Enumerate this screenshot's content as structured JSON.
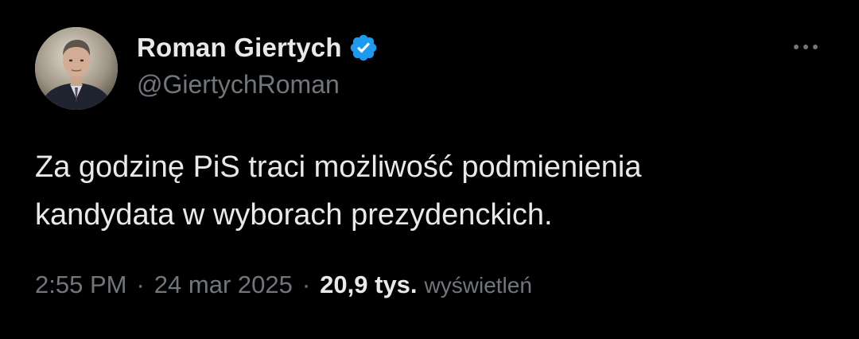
{
  "author": {
    "display_name": "Roman Giertych",
    "handle": "@GiertychRoman",
    "verified": true,
    "avatar_icon": "profile-photo"
  },
  "menu": {
    "icon": "more-horizontal-icon"
  },
  "tweet": {
    "text": "Za godzinę PiS traci możliwość podmienienia\nkandydata w wyborach prezydenckich.",
    "time": "2:55 PM",
    "date": "24 mar 2025",
    "separator": "·",
    "views_count": "20,9 tys.",
    "views_label": "wyświetleń"
  },
  "colors": {
    "background": "#000000",
    "primary_text": "#e7e9ea",
    "secondary_text": "#71767b",
    "verified_badge": "#1d9bf0"
  }
}
